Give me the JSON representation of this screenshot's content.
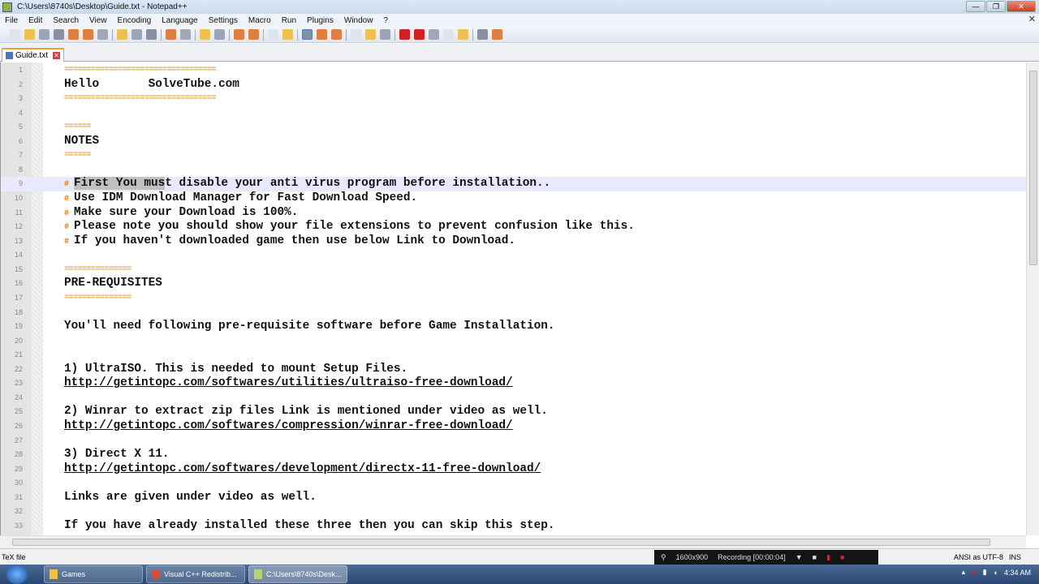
{
  "window": {
    "title": "C:\\Users\\8740s\\Desktop\\Guide.txt - Notepad++"
  },
  "menu": [
    "File",
    "Edit",
    "Search",
    "View",
    "Encoding",
    "Language",
    "Settings",
    "Macro",
    "Run",
    "Plugins",
    "Window",
    "?"
  ],
  "toolbar_icons": [
    "new-file",
    "open-file",
    "save",
    "save-all",
    "close",
    "close-all",
    "print",
    "|",
    "cut",
    "copy",
    "paste",
    "|",
    "undo",
    "redo",
    "|",
    "find",
    "replace",
    "|",
    "zoom-in",
    "zoom-out",
    "|",
    "sync-v",
    "sync-h",
    "|",
    "word-wrap",
    "show-all-chars",
    "indent-guide",
    "|",
    "doc-map",
    "function-list",
    "folder",
    "|",
    "record-macro",
    "stop-record",
    "play-macro",
    "run-macro-multiple",
    "save-macro",
    "|",
    "spell-check",
    "extra"
  ],
  "tab": {
    "label": "Guide.txt"
  },
  "editor": {
    "current_line": 9,
    "selected_text": "First You mus",
    "lines": [
      {
        "t": "==================================",
        "k": "sep"
      },
      {
        "t": "Hello       SolveTube.com"
      },
      {
        "t": "==================================",
        "k": "sep"
      },
      {
        "t": ""
      },
      {
        "t": "======",
        "k": "sep"
      },
      {
        "t": "NOTES"
      },
      {
        "t": "======",
        "k": "sep"
      },
      {
        "t": ""
      },
      {
        "t": "First You must disable your anti virus program before installation..",
        "k": "bul"
      },
      {
        "t": "Use IDM Download Manager for Fast Download Speed.",
        "k": "bul"
      },
      {
        "t": "Make sure your Download is 100%.",
        "k": "bul"
      },
      {
        "t": "Please note you should show your file extensions to prevent confusion like this.",
        "k": "bul"
      },
      {
        "t": "If you haven't downloaded game then use below Link to Download.",
        "k": "bul"
      },
      {
        "t": ""
      },
      {
        "t": "===============",
        "k": "sep"
      },
      {
        "t": "PRE-REQUISITES"
      },
      {
        "t": "===============",
        "k": "sep"
      },
      {
        "t": ""
      },
      {
        "t": "You'll need following pre-requisite software before Game Installation."
      },
      {
        "t": ""
      },
      {
        "t": ""
      },
      {
        "t": "1) UltraISO. This is needed to mount Setup Files."
      },
      {
        "t": "http://getintopc.com/softwares/utilities/ultraiso-free-download/",
        "k": "link"
      },
      {
        "t": ""
      },
      {
        "t": "2) Winrar to extract zip files Link is mentioned under video as well."
      },
      {
        "t": "http://getintopc.com/softwares/compression/winrar-free-download/",
        "k": "link"
      },
      {
        "t": ""
      },
      {
        "t": "3) Direct X 11."
      },
      {
        "t": "http://getintopc.com/softwares/development/directx-11-free-download/",
        "k": "link"
      },
      {
        "t": ""
      },
      {
        "t": "Links are given under video as well."
      },
      {
        "t": ""
      },
      {
        "t": "If you have already installed these three then you can skip this step."
      }
    ]
  },
  "status": {
    "file_type": "TeX file",
    "encoding": "ANSI as UTF-8",
    "mode": "INS"
  },
  "recorder": {
    "resolution": "1600x900",
    "status": "Recording [00:00:04]"
  },
  "taskbar": {
    "items": [
      {
        "label": "Games"
      },
      {
        "label": "Visual C++ Redistrib..."
      },
      {
        "label": "C:\\Users\\8740s\\Desk..."
      }
    ],
    "clock": "4:34 AM"
  }
}
